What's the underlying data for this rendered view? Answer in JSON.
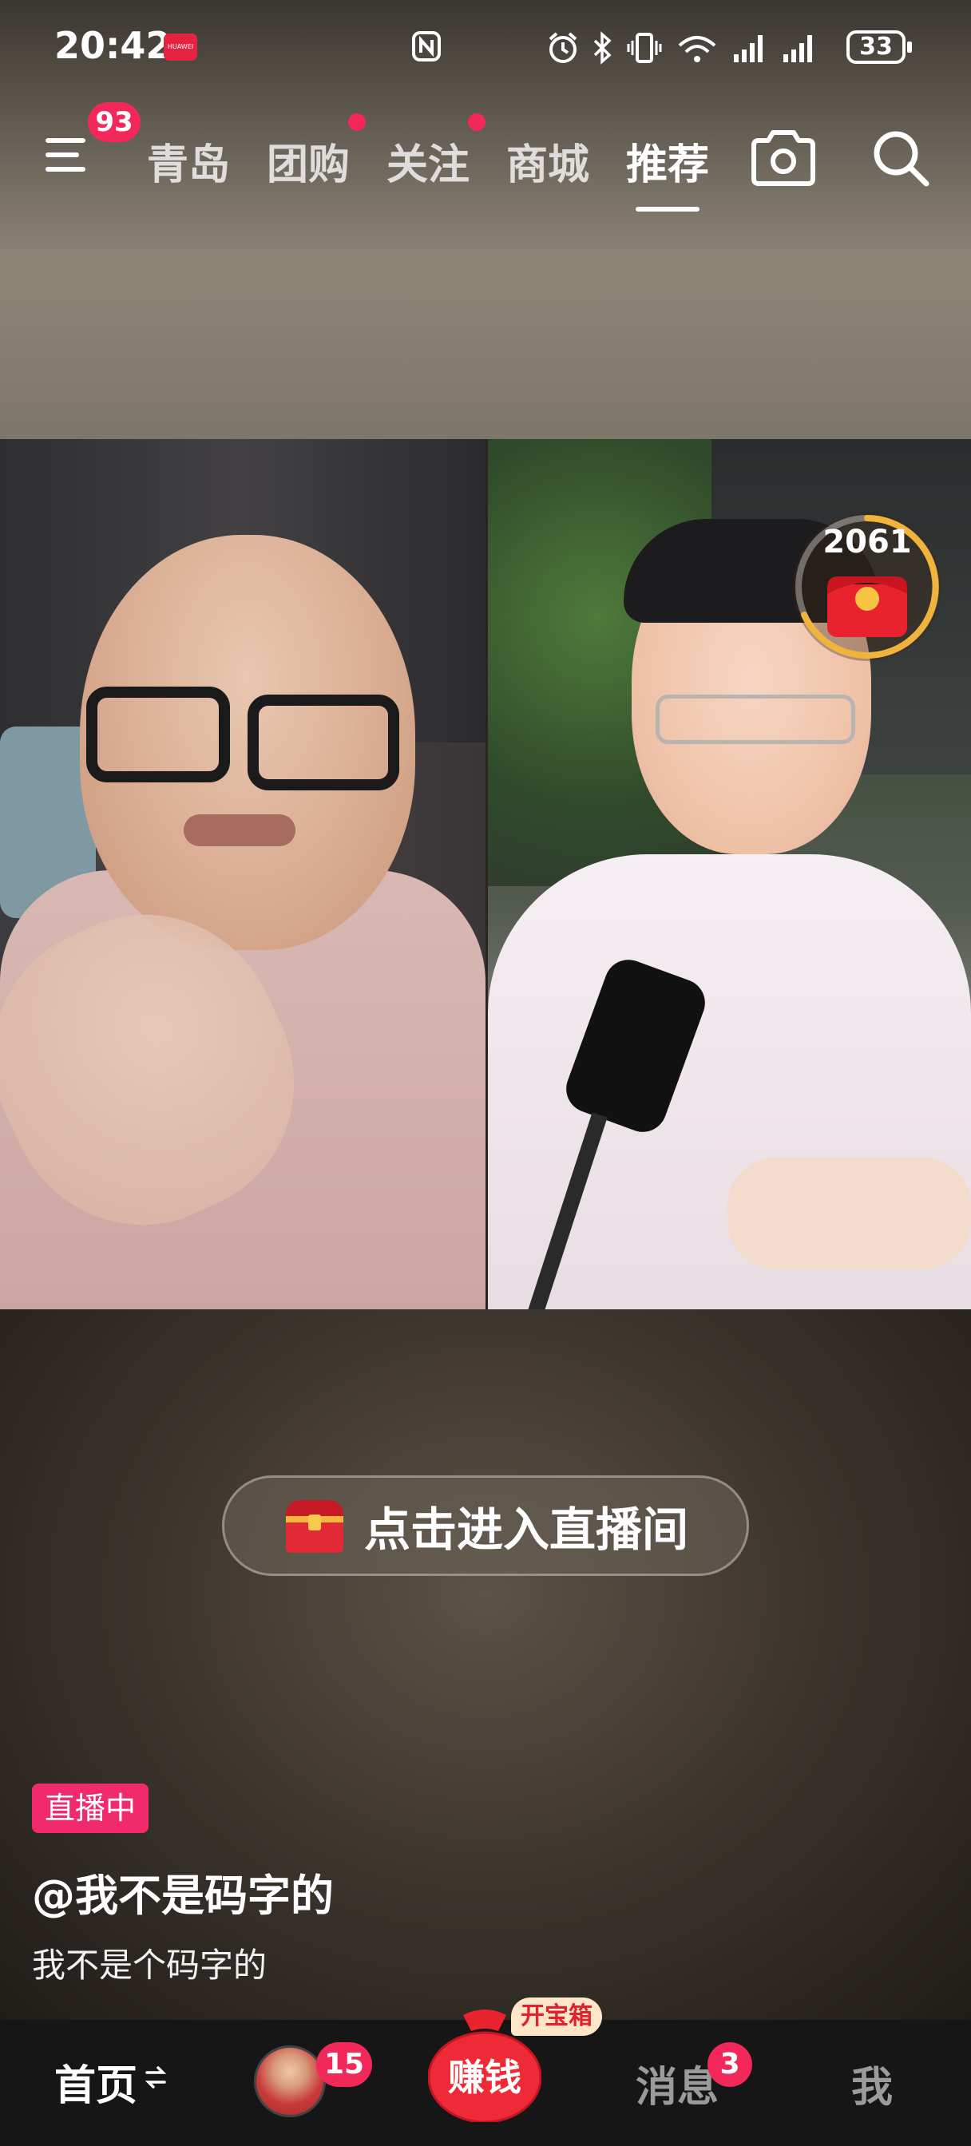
{
  "status_bar": {
    "time": "20:42",
    "battery": "33",
    "icons": [
      "huawei-icon",
      "nfc-icon",
      "alarm-icon",
      "bluetooth-icon",
      "vibrate-icon",
      "wifi-icon",
      "signal-icon",
      "signal-icon",
      "battery-icon"
    ]
  },
  "top_nav": {
    "menu_badge": "93",
    "tabs": [
      {
        "label": "青岛",
        "dot": false
      },
      {
        "label": "团购",
        "dot": true
      },
      {
        "label": "关注",
        "dot": true
      },
      {
        "label": "商城",
        "dot": false
      },
      {
        "label": "推荐",
        "active": true
      }
    ]
  },
  "live": {
    "coin_count": "2061",
    "enter_label": "点击进入直播间",
    "live_badge": "直播中",
    "handle": "@我不是码字的",
    "description": "我不是个码字的"
  },
  "bottom_nav": {
    "home": "首页",
    "avatar_badge": "15",
    "earn": "赚钱",
    "treasure_tag": "开宝箱",
    "messages": "消息",
    "messages_badge": "3",
    "me": "我"
  },
  "colors": {
    "accent_red": "#f3285a",
    "live_pink": "#f12a6c",
    "bottom_bar": "#161616"
  }
}
